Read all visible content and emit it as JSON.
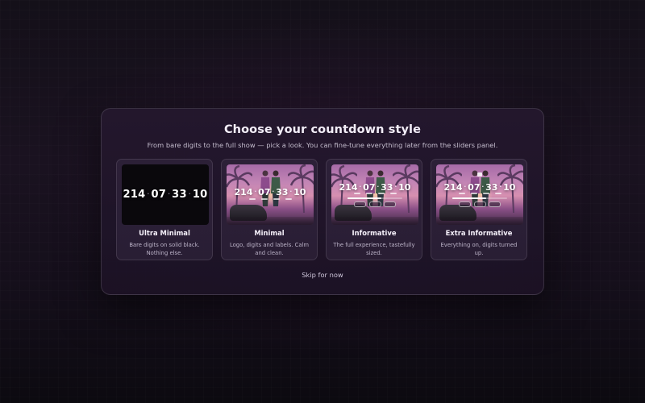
{
  "modal": {
    "title": "Choose your countdown style",
    "subtitle": "From bare digits to the full show — pick a look. You can fine-tune everything later from the sliders panel.",
    "skip_label": "Skip for now"
  },
  "countdown": {
    "days": "214",
    "hours": "07",
    "minutes": "33",
    "seconds": "10",
    "separator": "·"
  },
  "styles": [
    {
      "title": "Ultra Minimal",
      "description": "Bare digits on solid black. Nothing else."
    },
    {
      "title": "Minimal",
      "description": "Logo, digits and labels. Calm and clean."
    },
    {
      "title": "Informative",
      "description": "The full experience, tastefully sized."
    },
    {
      "title": "Extra Informative",
      "description": "Everything on, digits turned up."
    }
  ]
}
